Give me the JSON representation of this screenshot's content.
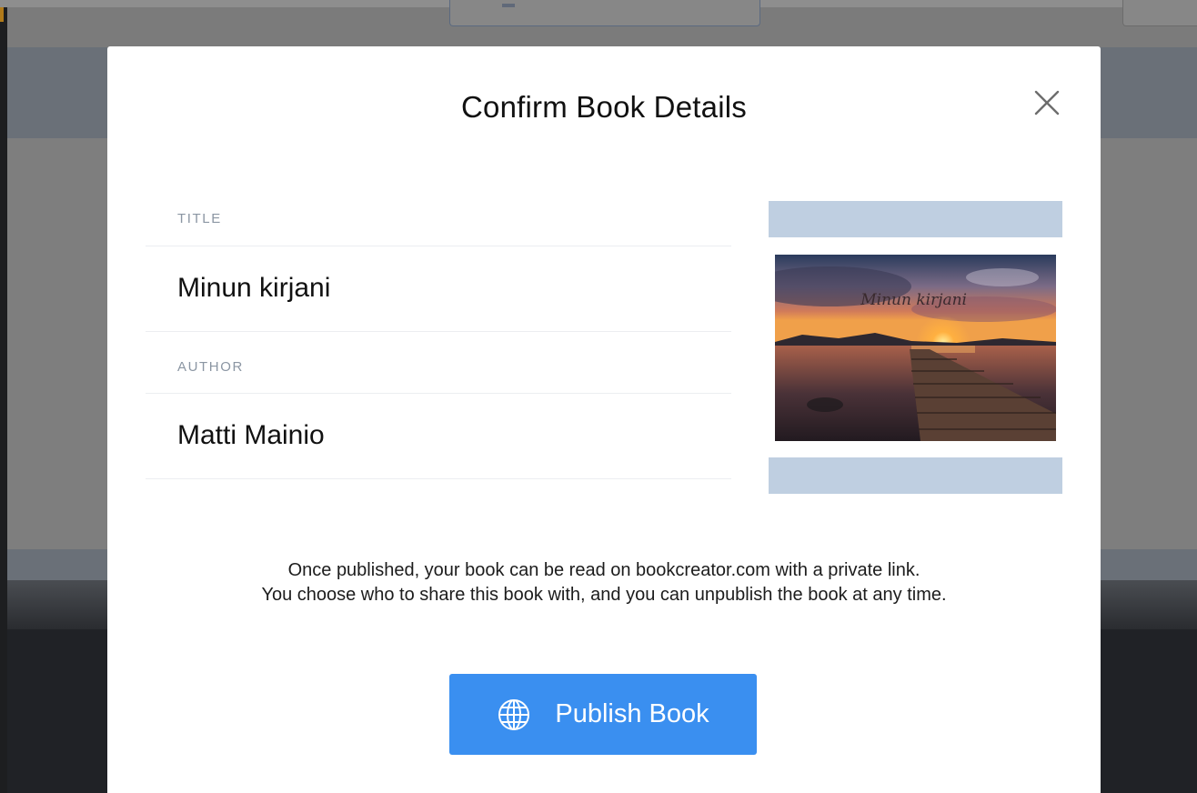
{
  "modal": {
    "title": "Confirm Book Details",
    "close_icon": "close-icon"
  },
  "fields": {
    "title_label": "TITLE",
    "title_value": "Minun kirjani",
    "author_label": "AUTHOR",
    "author_value": "Matti Mainio"
  },
  "cover": {
    "text": "Minun kirjani",
    "bar_color": "#bfcfe1"
  },
  "info": {
    "line1": "Once published, your book can be read on bookcreator.com with a private link.",
    "line2": "You choose who to share this book with, and you can unpublish the book at any time."
  },
  "publish_button": {
    "label": "Publish Book",
    "icon": "globe-icon",
    "color": "#3a8ff0"
  }
}
